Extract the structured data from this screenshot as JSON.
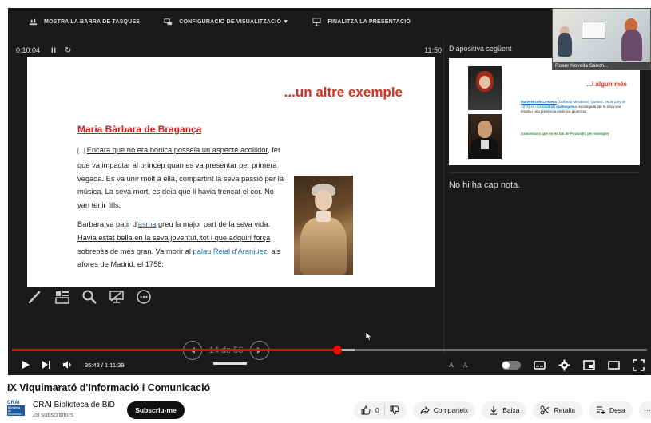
{
  "toolbar": {
    "taskbar_label": "MOSTRA LA BARRA DE TASQUES",
    "display_settings_label": "CONFIGURACIÓ DE VISUALITZACIÓ ▼",
    "end_show_label": "FINALITZA LA PRESENTACIÓ"
  },
  "presenter": {
    "elapsed": "0:10:04",
    "pause": "II",
    "reset": "↻",
    "clock": "11:50",
    "next_label": "Diapositiva següent",
    "notes": "No hi ha cap nota."
  },
  "slide": {
    "title": "...un altre exemple",
    "subtitle": "Maria Bàrbara de Bragança",
    "p1": {
      "lead": "[...] ",
      "u1": "Encara que no era bonica posseïa un aspecte acollidor",
      "t1": ", fet que va impactar al príncep quan es va presentar per primera vegada. Es va unir molt a ella, compartint la seva passió per la música. La seva mort, es deia que li havia trencat el cor. No van tenir fills."
    },
    "p2": {
      "t1": "Barbara va patir d'",
      "l1": "asma",
      "t2": " greu la major part de la seva vida. ",
      "u1": "Havia estat bella en la seva joventut, tot i que adquirí força sobrepès de més gran",
      "t3": ". Va morir al ",
      "l2": "palau Reial d'Aranjuez",
      "t4": ", als afores de Madrid, el 1758."
    }
  },
  "next_slide": {
    "title": "...i algun més",
    "name": "Marie-Nicole Lemieux",
    "text1": " (Dolbeau-Mistassini, Quebec, 26 de juny de 1975) és una ",
    "link1": "contralt quebequesa",
    "text2": " reconeguda per la seva veu àmplia i una presència escènica generosa.",
    "note": "(comentaris que no es fan de Pavarotti, per exemple)"
  },
  "webcam": {
    "name": "Roser Novella Sánch..."
  },
  "slide_nav": {
    "counter": "14 de 56"
  },
  "player": {
    "time": "36:43 / 1:11:39",
    "played_fraction": 0.512,
    "buffered_fraction": 0.54,
    "text_size_small": "A",
    "text_size_large": "A"
  },
  "video": {
    "title": "IX Viquimarató d'Informació i Comunicació",
    "channel_name": "CRAI Biblioteca de BiD",
    "subscribers": "28 subscriptors",
    "subscribe_label": "Subscriu-me",
    "avatar_top": "CRAI",
    "avatar_box": "Biblioteca de Informació i Mitjans Audiovisuals",
    "like_count": "0",
    "share_label": "Comparteix",
    "download_label": "Baixa",
    "clip_label": "Retalla",
    "save_label": "Desa",
    "more_label": "···"
  },
  "colors": {
    "accent_red": "#ff0000",
    "slide_title_red": "#d1311f",
    "link_blue": "#1f6fb2"
  }
}
